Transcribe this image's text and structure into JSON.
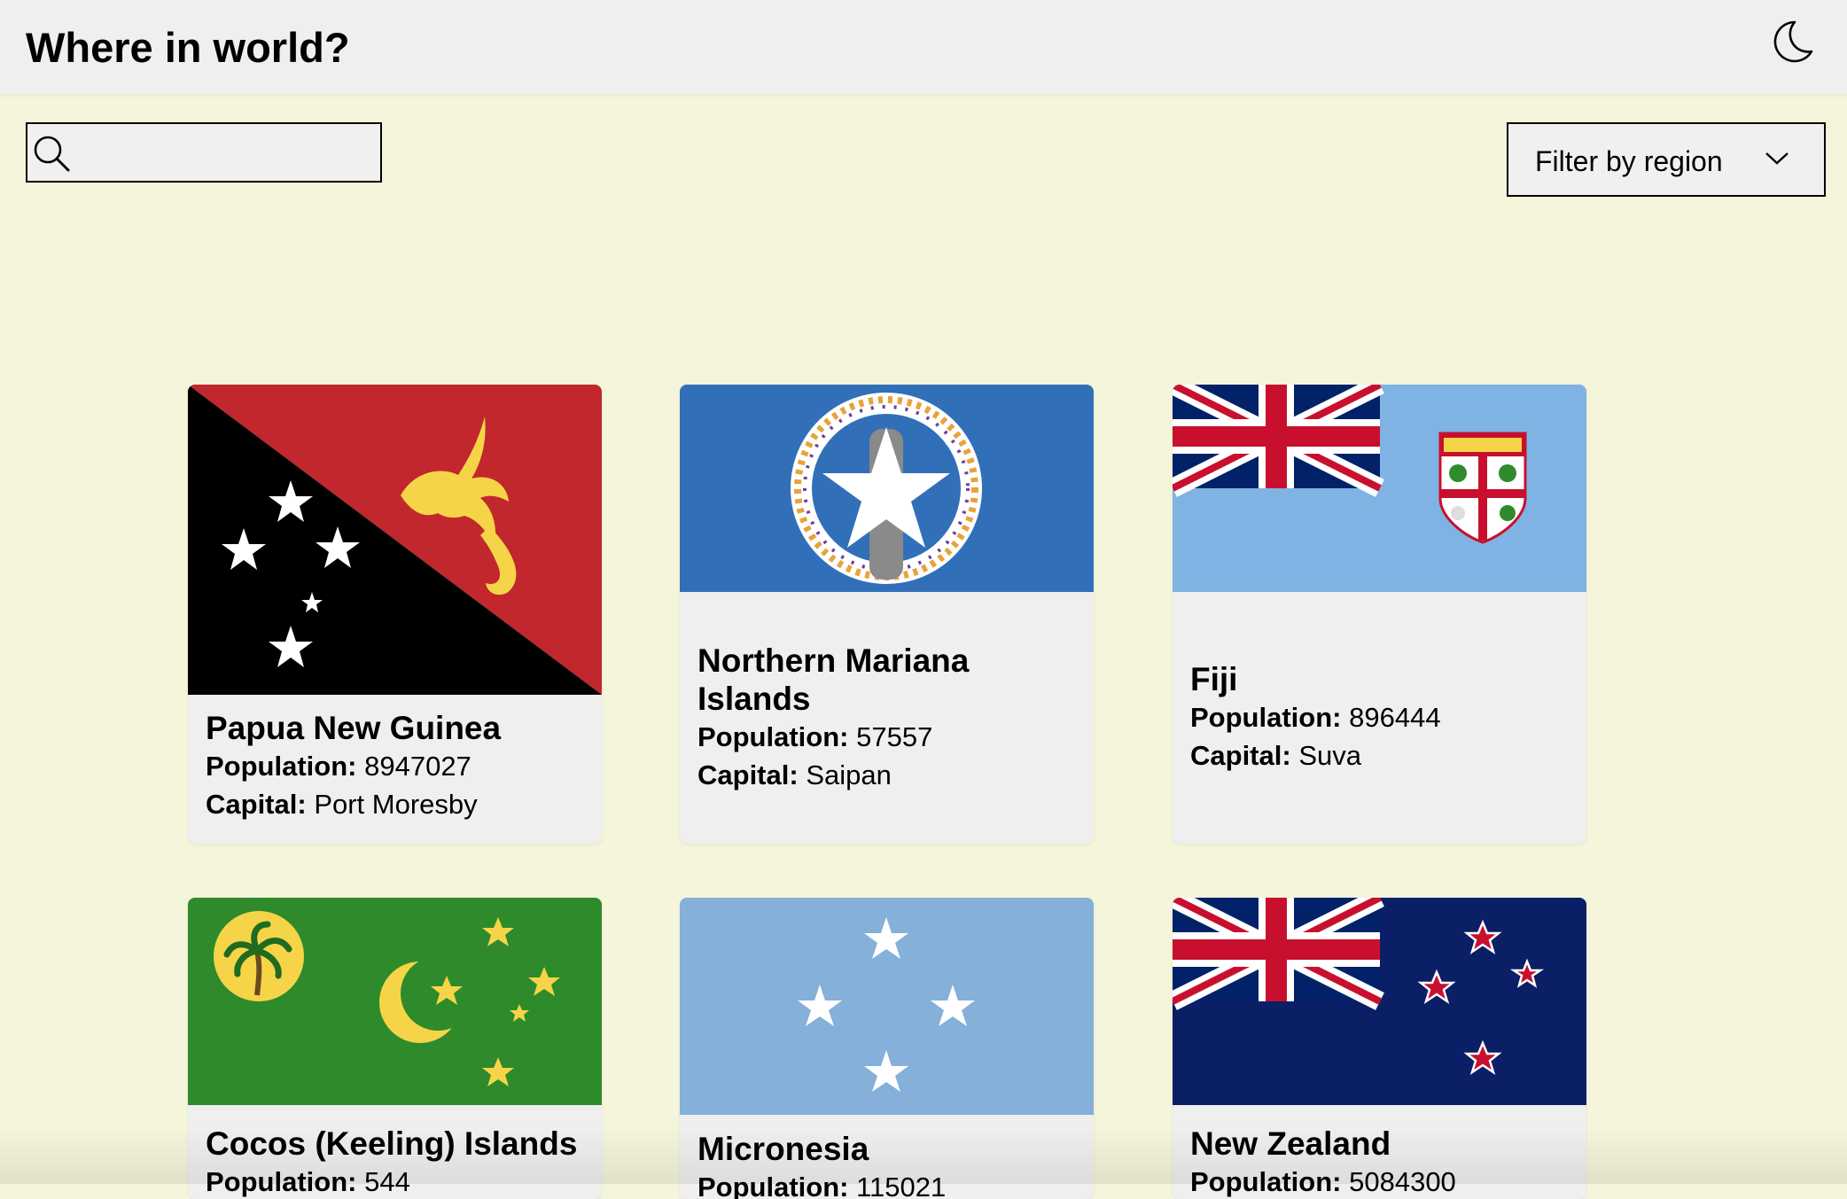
{
  "header": {
    "title": "Where in world?",
    "theme_toggle_icon": "moon-icon"
  },
  "search": {
    "icon": "search-icon",
    "value": "",
    "placeholder": ""
  },
  "filter": {
    "label": "Filter by region",
    "icon": "chevron-down-icon"
  },
  "stat_labels": {
    "population": "Population:",
    "capital": "Capital:"
  },
  "countries": [
    {
      "name": "Papua New Guinea",
      "population": "8947027",
      "capital": "Port Moresby"
    },
    {
      "name": "Northern Mariana Islands",
      "population": "57557",
      "capital": "Saipan"
    },
    {
      "name": "Fiji",
      "population": "896444",
      "capital": "Suva"
    },
    {
      "name": "Cocos (Keeling) Islands",
      "population": "544",
      "capital": ""
    },
    {
      "name": "Micronesia",
      "population": "115021",
      "capital": ""
    },
    {
      "name": "New Zealand",
      "population": "5084300",
      "capital": ""
    }
  ],
  "colors": {
    "page_background": "#f5f5dc",
    "header_background": "#efefef",
    "card_background": "#efefef"
  }
}
